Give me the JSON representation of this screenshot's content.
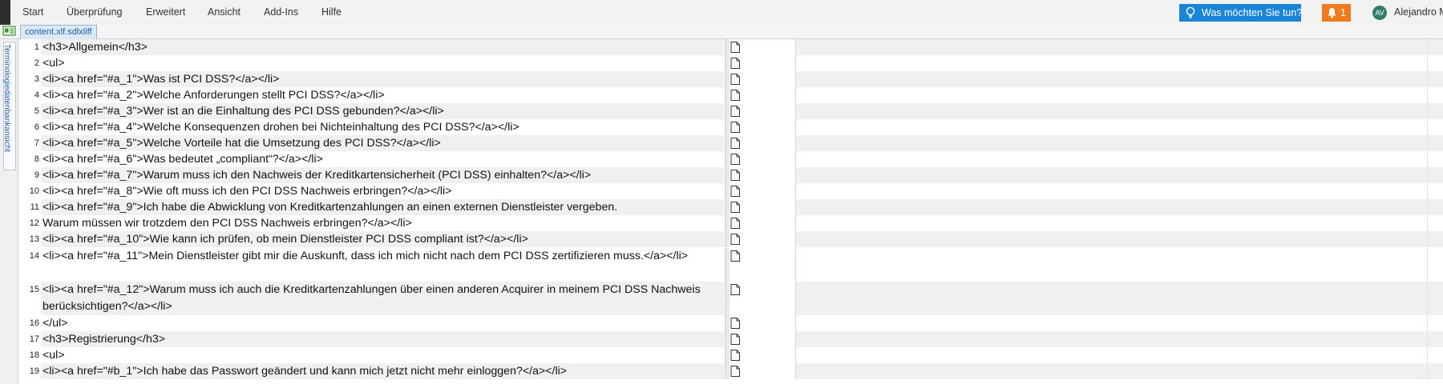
{
  "menu": {
    "items": [
      "Start",
      "Überprüfung",
      "Erweitert",
      "Ansicht",
      "Add-Ins",
      "Hilfe"
    ],
    "tell_me": "Was möchten Sie tun?",
    "notifications": "1",
    "avatar_initials": "AV",
    "user_name": "Alejandro M"
  },
  "document_tab": "content.xlf.sdlxliff",
  "side_panel_label": "Terminologiedatenbankansicht",
  "colors": {
    "tell_me_bg": "#1a84d6",
    "notification_bg": "#f07b1e",
    "avatar_bg": "#2e7d6f",
    "tab_text": "#1c5fa8",
    "row_shade": "#f0f0f0"
  },
  "segments": [
    {
      "num": "1",
      "text": "<h3>Allgemein</h3>"
    },
    {
      "num": "2",
      "text": "<ul>"
    },
    {
      "num": "3",
      "text": "<li><a href=\"#a_1\">Was ist PCI DSS?</a></li>"
    },
    {
      "num": "4",
      "text": "<li><a href=\"#a_2\">Welche Anforderungen stellt PCI DSS?</a></li>"
    },
    {
      "num": "5",
      "text": "<li><a href=\"#a_3\">Wer ist an die Einhaltung des PCI DSS gebunden?</a></li>"
    },
    {
      "num": "6",
      "text": "<li><a href=\"#a_4\">Welche Konsequenzen drohen bei Nichteinhaltung des PCI DSS?</a></li>"
    },
    {
      "num": "7",
      "text": "<li><a href=\"#a_5\">Welche Vorteile hat die Umsetzung des PCI DSS?</a></li>"
    },
    {
      "num": "8",
      "text": "<li><a href=\"#a_6\">Was bedeutet „compliant“?</a></li>"
    },
    {
      "num": "9",
      "text": "<li><a href=\"#a_7\">Warum muss ich den Nachweis der Kreditkartensicherheit (PCI DSS) einhalten?</a></li>"
    },
    {
      "num": "10",
      "text": "<li><a href=\"#a_8\">Wie oft muss ich den PCI DSS Nachweis erbringen?</a></li>"
    },
    {
      "num": "11",
      "text": "<li><a href=\"#a_9\">Ich habe die Abwicklung von Kreditkartenzahlungen an einen externen Dienstleister vergeben."
    },
    {
      "num": "12",
      "text": "Warum müssen wir trotzdem den PCI DSS Nachweis erbringen?</a></li>"
    },
    {
      "num": "13",
      "text": "<li><a href=\"#a_10\">Wie kann ich prüfen, ob mein Dienstleister PCI DSS compliant ist?</a></li>"
    },
    {
      "num": "14",
      "text": "<li><a href=\"#a_11\">Mein Dienstleister gibt mir die Auskunft, dass ich mich nicht nach dem PCI DSS zertifizieren muss.</a></li>"
    },
    {
      "num": "15",
      "text": "<li><a href=\"#a_12\">Warum muss ich auch die Kreditkartenzahlungen über einen anderen Acquirer in meinem PCI DSS Nachweis berücksichtigen?</a></li>"
    },
    {
      "num": "16",
      "text": "</ul>"
    },
    {
      "num": "17",
      "text": "<h3>Registrierung</h3>"
    },
    {
      "num": "18",
      "text": "<ul>"
    },
    {
      "num": "19",
      "text": "<li><a href=\"#b_1\">Ich habe das Passwort geändert und kann mich jetzt nicht mehr einloggen?</a></li>"
    }
  ]
}
